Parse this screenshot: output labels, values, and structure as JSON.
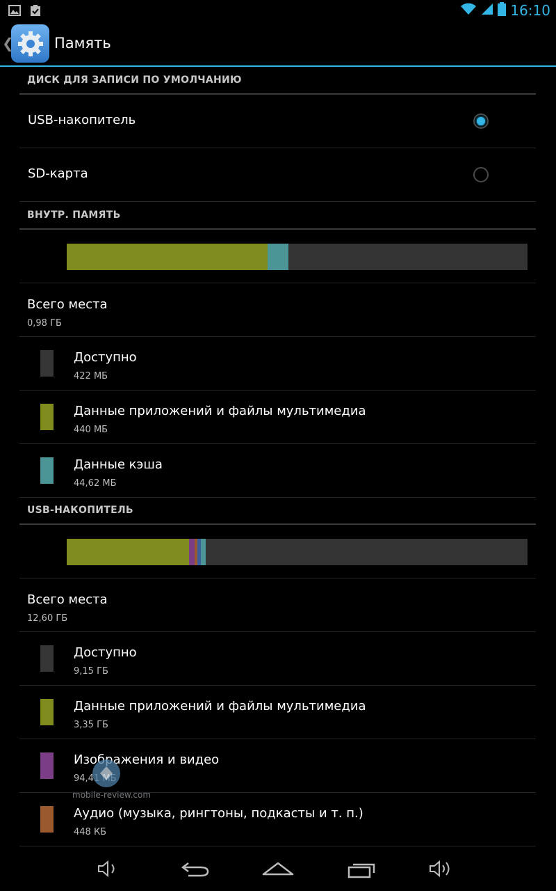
{
  "status_bar": {
    "time": "16:10",
    "left_icons": [
      "gallery-icon",
      "clipboard-check-icon"
    ],
    "right_icons": [
      "wifi-icon",
      "signal-icon",
      "battery-icon"
    ],
    "accent_color": "#33b5e5"
  },
  "action_bar": {
    "title": "Память",
    "icon": "settings-gear-icon"
  },
  "default_disk": {
    "header": "ДИСК ДЛЯ ЗАПИСИ ПО УМОЛЧАНИЮ",
    "options": [
      {
        "label": "USB-накопитель",
        "selected": true
      },
      {
        "label": "SD-карта",
        "selected": false
      }
    ]
  },
  "internal": {
    "header": "ВНУТР. ПАМЯТЬ",
    "bar_segments": [
      {
        "name": "apps",
        "fraction": 0.436,
        "color": "#7f8b1d"
      },
      {
        "name": "cache",
        "fraction": 0.045,
        "color": "#4c9597"
      }
    ],
    "total_title": "Всего места",
    "total_value": "0,98 ГБ",
    "items": [
      {
        "title": "Доступно",
        "value": "422 МБ",
        "color": "#363636"
      },
      {
        "title": "Данные приложений и файлы мультимедиа",
        "value": "440 МБ",
        "color": "#7f8b1d"
      },
      {
        "title": "Данные кэша",
        "value": "44,62 МБ",
        "color": "#4c9597"
      }
    ]
  },
  "usb": {
    "header": "USB-НАКОПИТЕЛЬ",
    "bar_segments": [
      {
        "name": "apps",
        "fraction": 0.266,
        "color": "#7f8b1d"
      },
      {
        "name": "images",
        "fraction": 0.011,
        "color": "#7b3d86"
      },
      {
        "name": "audio",
        "fraction": 0.006,
        "color": "#9a5a2e"
      },
      {
        "name": "downloads",
        "fraction": 0.008,
        "color": "#3c5f9e"
      },
      {
        "name": "misc",
        "fraction": 0.01,
        "color": "#4c9597"
      }
    ],
    "total_title": "Всего места",
    "total_value": "12,60 ГБ",
    "items": [
      {
        "title": "Доступно",
        "value": "9,15 ГБ",
        "color": "#363636"
      },
      {
        "title": "Данные приложений и файлы мультимедиа",
        "value": "3,35 ГБ",
        "color": "#7f8b1d"
      },
      {
        "title": "Изображения и видео",
        "value": "94,41 МБ",
        "color": "#7b3d86"
      },
      {
        "title": "Аудио (музыка, рингтоны, подкасты и т. п.)",
        "value": "448 КБ",
        "color": "#9a5a2e"
      }
    ]
  },
  "watermark": "mobile-review.com",
  "nav_bar": {
    "icons": [
      "volume-down-icon",
      "back-icon",
      "home-icon",
      "recent-apps-icon",
      "volume-up-icon"
    ]
  }
}
